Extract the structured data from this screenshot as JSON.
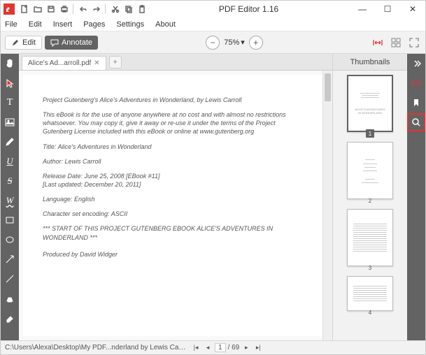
{
  "app": {
    "title": "PDF Editor 1.16"
  },
  "menu": {
    "file": "File",
    "edit": "Edit",
    "insert": "Insert",
    "pages": "Pages",
    "settings": "Settings",
    "about": "About"
  },
  "toolbar": {
    "edit": "Edit",
    "annotate": "Annotate",
    "zoom": "75%"
  },
  "tab": {
    "name": "Alice's Ad...arroll.pdf"
  },
  "thumbs": {
    "title": "Thumbnails",
    "nums": {
      "p1": "1",
      "p2": "2",
      "p3": "3",
      "p4": "4"
    }
  },
  "doc": {
    "l1": "Project Gutenberg's Alice's Adventures in Wonderland, by Lewis Carroll",
    "l2": "This eBook is for the use of anyone anywhere at no cost and with almost no restrictions whatsoever.  You may copy it, give it away or re-use it under the terms of the Project Gutenberg License included with this eBook or online at www.gutenberg.org",
    "l3": "Title: Alice's Adventures in Wonderland",
    "l4": "Author: Lewis Carroll",
    "l5": "Release Date: June 25, 2008 [EBook #11]",
    "l6": "[Last updated: December 20, 2011]",
    "l7": "Language: English",
    "l8": "Character set encoding: ASCII",
    "l9": "*** START OF THIS PROJECT GUTENBERG EBOOK ALICE'S ADVENTURES IN WONDERLAND ***",
    "l10": "Produced by David Widger"
  },
  "status": {
    "path": "C:\\Users\\Alexa\\Desktop\\My PDF...nderland by Lewis Carroll.pdf",
    "page": "1",
    "total": "/ 69"
  }
}
